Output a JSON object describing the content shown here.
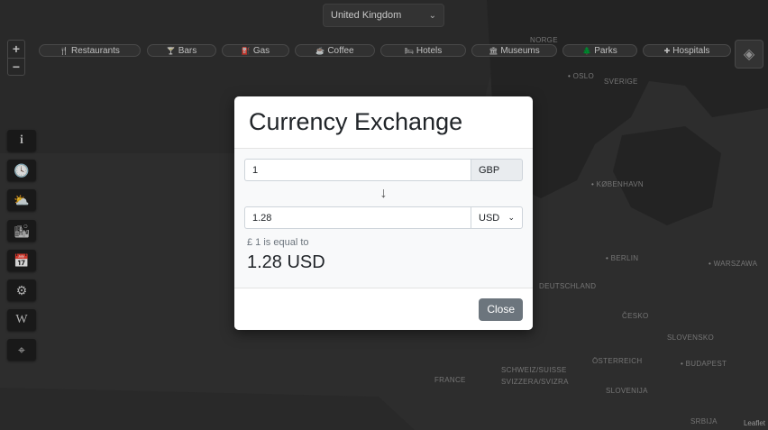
{
  "country_select": {
    "value": "United Kingdom"
  },
  "zoom": {
    "in": "+",
    "out": "−"
  },
  "categories": [
    {
      "icon": "🍴",
      "label": "Restaurants"
    },
    {
      "icon": "🍸",
      "label": "Bars"
    },
    {
      "icon": "⛽",
      "label": "Gas"
    },
    {
      "icon": "☕",
      "label": "Coffee"
    },
    {
      "icon": "🛏",
      "label": "Hotels"
    },
    {
      "icon": "🏛",
      "label": "Museums"
    },
    {
      "icon": "🌲",
      "label": "Parks"
    },
    {
      "icon": "✚",
      "label": "Hospitals"
    }
  ],
  "tools": [
    {
      "icon": "i"
    },
    {
      "icon": "🕓"
    },
    {
      "icon": "⛅"
    },
    {
      "icon": "🏙"
    },
    {
      "icon": "📅"
    },
    {
      "icon": "⚙"
    },
    {
      "icon": "W"
    },
    {
      "icon": "⌖"
    }
  ],
  "map_labels": [
    "NORGE",
    "OSLO",
    "SVERIGE",
    "KØBENHAVN",
    "BERLIN",
    "WARSZAWA",
    "DEUTSCHLAND",
    "ČESKO",
    "SLOVENSKO",
    "ÖSTERREICH",
    "BUDAPEST",
    "SCHWEIZ/SUISSE",
    "SVIZZERA/SVIZRA",
    "FRANCE",
    "SLOVENIJA",
    "SRBIJA"
  ],
  "modal": {
    "title": "Currency Exchange",
    "from_amount": "1",
    "from_currency": "GBP",
    "to_amount": "1.28",
    "to_currency": "USD",
    "equal_label": "£ 1 is equal to",
    "result": "1.28 USD",
    "close_label": "Close"
  },
  "attribution": "Leaflet"
}
